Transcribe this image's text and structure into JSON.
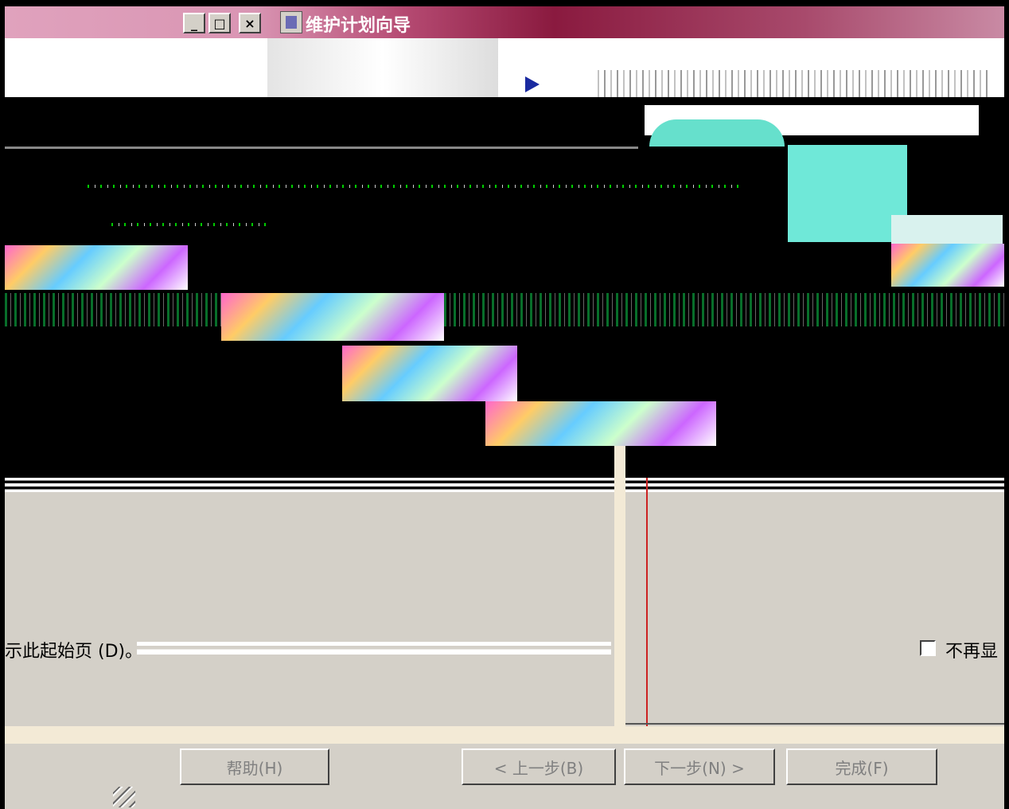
{
  "window": {
    "title": "维护计划向导",
    "controls": {
      "minimize": "_",
      "maximize": "□",
      "close": "×"
    }
  },
  "content": {
    "dont_show_left": "示此起始页 (D)。",
    "dont_show_right": "不再显"
  },
  "buttons": {
    "help": "帮助(H)",
    "back": "< 上一步(B)",
    "next": "下一步(N) >",
    "finish": "完成(F)"
  },
  "colors": {
    "title_accent": "#8a1a3f",
    "header_arrow": "#1a2aa0",
    "graphic_teal": "#6fe8d8",
    "dialog_gray": "#d4d0c8"
  },
  "icons": [
    "wizard-icon",
    "header-arrow-icon",
    "size-grip-icon"
  ]
}
